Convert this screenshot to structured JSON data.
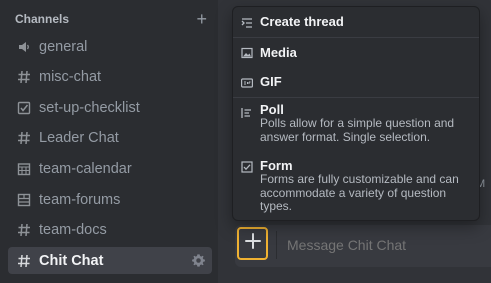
{
  "sidebar": {
    "section_title": "Channels",
    "add_channel_icon": "plus-icon",
    "channels": [
      {
        "label": "general",
        "icon": "speaker-icon",
        "active": false
      },
      {
        "label": "misc-chat",
        "icon": "hash-icon",
        "active": false
      },
      {
        "label": "set-up-checklist",
        "icon": "checkbox-icon",
        "active": false
      },
      {
        "label": "Leader Chat",
        "icon": "hash-icon",
        "active": false
      },
      {
        "label": "team-calendar",
        "icon": "calendar-icon",
        "active": false
      },
      {
        "label": "team-forums",
        "icon": "forum-icon",
        "active": false
      },
      {
        "label": "team-docs",
        "icon": "hash-icon",
        "active": false
      },
      {
        "label": "Chit Chat",
        "icon": "hash-icon",
        "active": true,
        "settings_icon": "gear-icon"
      }
    ]
  },
  "menu": {
    "items": [
      {
        "title": "Create thread",
        "icon": "thread-icon"
      },
      {
        "title": "Media",
        "icon": "image-icon"
      },
      {
        "title": "GIF",
        "icon": "gif-icon"
      },
      {
        "title": "Poll",
        "icon": "poll-icon",
        "description": "Polls allow for a simple question and answer format. Single selection."
      },
      {
        "title": "Form",
        "icon": "form-checkbox-icon",
        "description": "Forms are fully customizable and can accommodate a variety of question types."
      }
    ]
  },
  "composer": {
    "placeholder": "Message Chit Chat",
    "attach_icon": "plus-icon",
    "accent_color": "#f0b232"
  },
  "background_fragment": "M"
}
